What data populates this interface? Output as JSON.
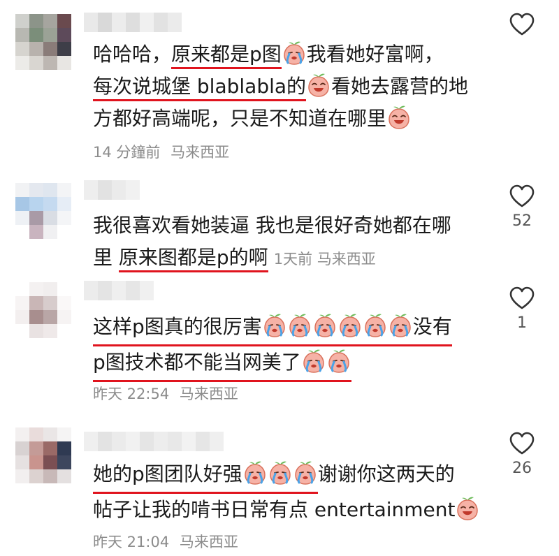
{
  "comments": [
    {
      "lines": [
        {
          "pre": "哈哈哈，",
          "ul": "原来都是p图",
          "post": "我看她好富啊，"
        },
        {
          "pre": "",
          "ul": "每次说城堡 blablabla的",
          "post": "看她去露营的地"
        },
        {
          "pre": "方都好高端呢，只是不知道在哪里",
          "ul": "",
          "post": ""
        }
      ],
      "time": "14 分鐘前",
      "location": "马来西亚",
      "likes": ""
    },
    {
      "lines": [
        {
          "pre": "我很喜欢看她装逼 我也是很好奇她都在哪",
          "ul": "",
          "post": ""
        },
        {
          "pre": "里 ",
          "ul": "原来图都是p的啊",
          "post": ""
        }
      ],
      "time": "1天前",
      "location": "马来西亚",
      "likes": "52"
    },
    {
      "lines": [
        {
          "pre": "",
          "ul": "这样p图真的很厉害",
          "post": ""
        },
        {
          "pre": "",
          "ul": "p图技术都不能当网美了",
          "post": ""
        }
      ],
      "tail_text_1": "没有",
      "time": "昨天 22:54",
      "location": "马来西亚",
      "likes": "1"
    },
    {
      "lines": [
        {
          "pre": "",
          "ul": "她的p图团队好强",
          "post": "谢谢你这两天的"
        },
        {
          "pre": "帖子让我的啃书日常有点 entertainment",
          "ul": "",
          "post": ""
        }
      ],
      "time": "昨天 21:04",
      "location": "马来西亚",
      "likes": "26"
    }
  ],
  "colors": {
    "underline": "#e0141e",
    "meta": "#8c8c8c"
  },
  "icons": [
    "heart-outline-icon",
    "crying-peach-emoji",
    "laughing-peach-emoji"
  ]
}
